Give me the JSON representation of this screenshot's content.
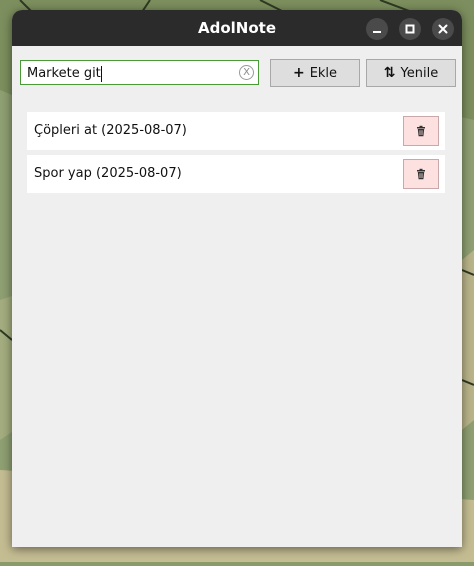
{
  "window": {
    "title": "AdolNote",
    "controls": [
      "minimize-icon",
      "maximize-icon",
      "close-icon"
    ]
  },
  "toolbar": {
    "search_value": "Markete git",
    "clear_label": "X",
    "add_icon": "+",
    "add_label": "Ekle",
    "refresh_icon": "⇅",
    "refresh_label": "Yenile"
  },
  "todos": [
    {
      "label": "Çöpleri at (2025-08-07)",
      "delete_icon": "trash-icon"
    },
    {
      "label": "Spor yap (2025-08-07)",
      "delete_icon": "trash-icon"
    }
  ],
  "colors": {
    "titlebar": "#2b2b2b",
    "window_bg": "#efefef",
    "input_focus_border": "#4a9a3a",
    "delete_button_bg": "#fde0e0"
  }
}
